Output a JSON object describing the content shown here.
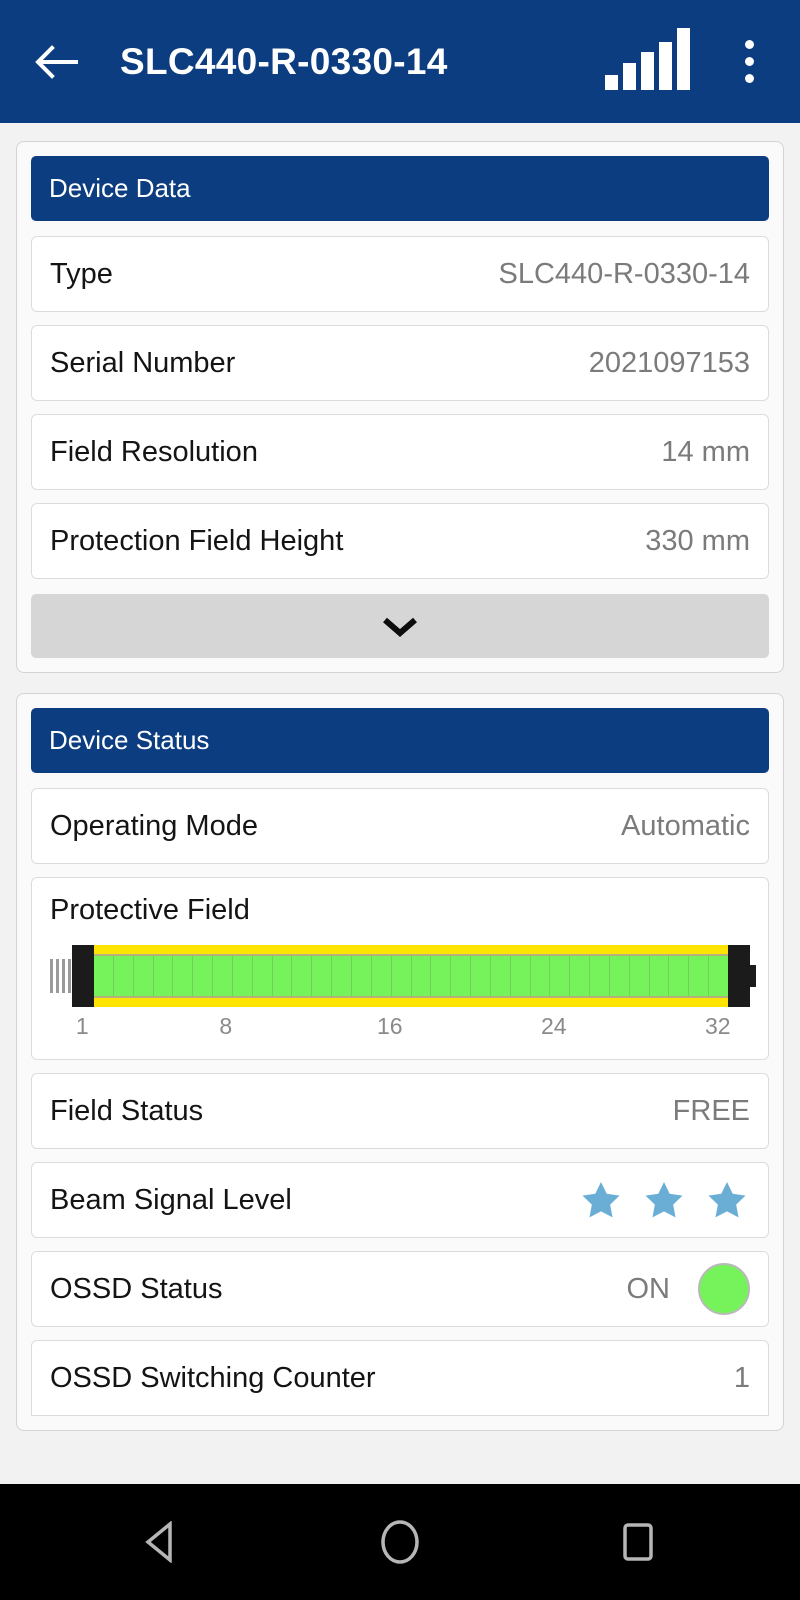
{
  "appbar": {
    "title": "SLC440-R-0330-14",
    "back_icon": "arrow-left-icon",
    "signal_icon": "signal-bars-icon",
    "overflow_icon": "overflow-menu-icon"
  },
  "device_data": {
    "header": "Device Data",
    "rows": [
      {
        "label": "Type",
        "value": "SLC440-R-0330-14"
      },
      {
        "label": "Serial Number",
        "value": "2021097153"
      },
      {
        "label": "Field Resolution",
        "value": "14 mm"
      },
      {
        "label": "Protection Field Height",
        "value": "330 mm"
      }
    ],
    "expand_icon": "chevron-down-icon"
  },
  "device_status": {
    "header": "Device Status",
    "operating_mode": {
      "label": "Operating Mode",
      "value": "Automatic"
    },
    "protective_field": {
      "label": "Protective Field",
      "beam_count": 32,
      "scale_ticks": [
        "1",
        "8",
        "16",
        "24",
        "32"
      ],
      "beam_color": "#76f35a",
      "housing_color": "#ffe400",
      "status": "free"
    },
    "field_status": {
      "label": "Field Status",
      "value": "FREE"
    },
    "beam_signal_level": {
      "label": "Beam Signal Level",
      "stars": 3,
      "star_color": "#6aaed6"
    },
    "ossd_status": {
      "label": "OSSD Status",
      "value": "ON",
      "led_color": "#76f35a"
    },
    "ossd_switching_counter": {
      "label": "OSSD Switching Counter",
      "value": "1"
    }
  },
  "navbar": {
    "back_icon": "nav-back-icon",
    "home_icon": "nav-home-icon",
    "recents_icon": "nav-recents-icon"
  }
}
